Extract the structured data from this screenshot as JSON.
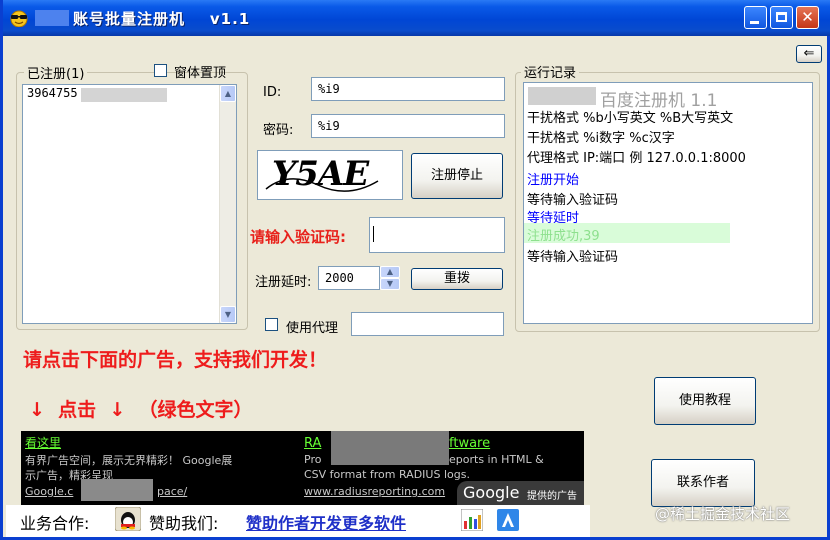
{
  "window": {
    "title": "账号批量注册机    v1.1",
    "colors": {
      "titlebar": "#0046d5",
      "face": "#ece9d8"
    }
  },
  "registered": {
    "group_label": "已注册(1)",
    "items": [
      "3964755"
    ]
  },
  "topmost": {
    "label": "窗体置顶",
    "checked": false
  },
  "form": {
    "id_label": "ID:",
    "id_value": "%i9",
    "password_label": "密码:",
    "password_value": "%i9",
    "captcha_text": "Y5AE",
    "register_button": "注册停止",
    "captcha_prompt": "请输入验证码:",
    "captcha_value": "",
    "delay_label": "注册延时:",
    "delay_value": "2000",
    "reset_button": "重拨",
    "proxy_label": "使用代理",
    "proxy_checked": false,
    "proxy_value": ""
  },
  "log": {
    "group_label": "运行记录",
    "back_icon": "arrow-left-icon",
    "lines": [
      {
        "text": "百度注册机 1.1",
        "color": "#a0a0a0"
      },
      {
        "text": "干扰格式  %b小写英文 %B大写英文",
        "color": "#000000"
      },
      {
        "text": "干扰格式  %i数字 %c汉字",
        "color": "#000000"
      },
      {
        "text": "代理格式  IP:端口   例 127.0.0.1:8000",
        "color": "#000000"
      },
      {
        "text": "注册开始",
        "color": "#0000ff"
      },
      {
        "text": "等待输入验证码",
        "color": "#000000"
      },
      {
        "text": "等待延时",
        "color": "#0000ff"
      },
      {
        "text": "注册成功,39",
        "color": "#8ee08e"
      },
      {
        "text": "等待输入验证码",
        "color": "#000000"
      }
    ]
  },
  "promo": {
    "headline": "请点击下面的广告，支持我们开发！",
    "subline": "↓  点击  ↓  （绿色文字）"
  },
  "buttons": {
    "tutorial": "使用教程",
    "contact": "联系作者"
  },
  "ads": {
    "left_title": "看这里",
    "left_body_1": "有界广告空间，展示无界精彩！ Google展",
    "left_body_2": "示广告，精彩呈现",
    "left_url": "Google.c",
    "left_url_tail": "pace/",
    "right_title": "RA",
    "right_title_tail": "ftware",
    "right_body_1": "Pro",
    "right_body_1_tail": "eports in HTML &",
    "right_body_2": "CSV format from RADIUS logs.",
    "right_url": "www.radiusreporting.com",
    "badge_google": "Google",
    "badge_text": "提供的广告"
  },
  "footer": {
    "business_label": "业务合作:",
    "sponsor_label": "赞助我们:",
    "sponsor_link": "赞助作者开发更多软件",
    "qq_icon": "qq-penguin-icon",
    "stats_icon": "cnzz-stats-icon",
    "app_icon": "app-store-icon"
  },
  "watermark": "@稀土掘金技术社区"
}
